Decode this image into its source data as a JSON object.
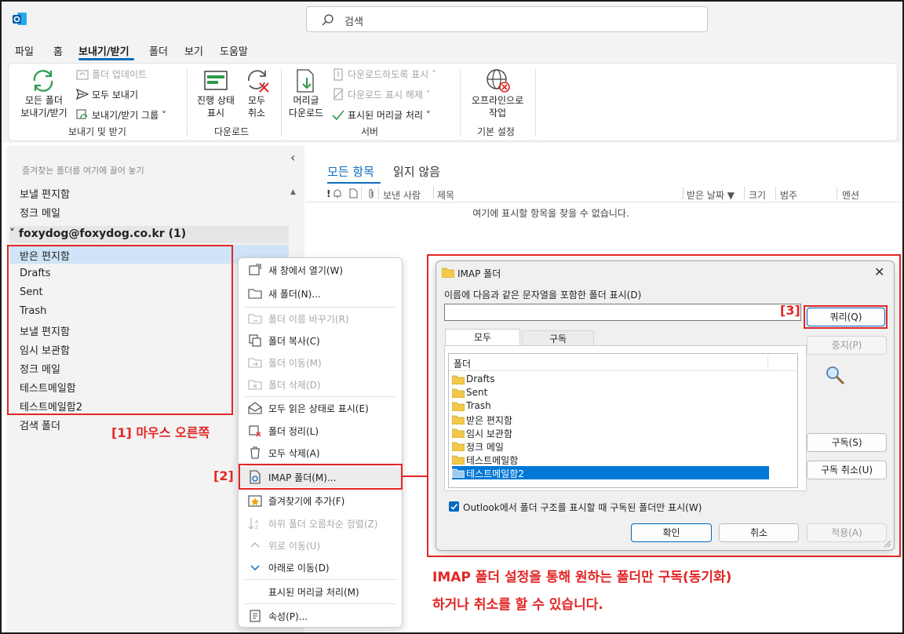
{
  "app": {
    "icon": "outlook-icon"
  },
  "search": {
    "placeholder": "검색"
  },
  "menu": {
    "items": [
      "파일",
      "홈",
      "보내기/받기",
      "폴더",
      "보기",
      "도움말"
    ],
    "active": "보내기/받기"
  },
  "ribbon": {
    "groups": [
      {
        "name": "보내기 및 받기",
        "send_receive_all": "모든 폴더\n보내기/받기",
        "update_folder": "폴더 업데이트",
        "send_all": "모두 보내기",
        "send_receive_groups": "보내기/받기 그룹 ˅"
      },
      {
        "name": "다운로드",
        "show_progress": "진행 상태\n표시",
        "cancel_all": "모두\n취소"
      },
      {
        "name": "서버",
        "download_headers": "머리글\n다운로드",
        "mark_download": "다운로드하도록 표시 ˅",
        "unmark_download": "다운로드 표시 해제 ˅",
        "process_marked": "표시된 머리글 처리 ˅"
      },
      {
        "name": "기본 설정",
        "work_offline": "오프라인으로\n작업"
      }
    ]
  },
  "leftpane": {
    "collapse": "‹",
    "favorites_hint": "즐겨찾는 폴더를 여기에 끌어 놓기",
    "favorites": [
      "보낼 편지함",
      "정크 메일"
    ],
    "account": "˅ foxydog@foxydog.co.kr (1)",
    "folders": [
      "받은 편지함",
      "Drafts",
      "Sent",
      "Trash",
      "보낼 편지함",
      "임시 보관함",
      "정크 메일",
      "테스트메일함",
      "테스트메일함2",
      "검색 폴더"
    ]
  },
  "mailpane": {
    "tabs": [
      "모든 항목",
      "읽지 않음"
    ],
    "columns": [
      "!",
      "보낸 사람",
      "제목",
      "받은 날짜 ▼",
      "크기",
      "범주",
      "멘션"
    ],
    "empty_message": "여기에 표시할 항목을 찾을 수 없습니다."
  },
  "context_menu": {
    "items": [
      {
        "label": "새 창에서 열기(W)",
        "icon": "new-window-icon",
        "enabled": true
      },
      {
        "label": "새 폴더(N)...",
        "icon": "new-folder-icon",
        "enabled": true
      },
      {
        "label": "폴더 이름 바꾸기(R)",
        "icon": "rename-folder-icon",
        "enabled": false
      },
      {
        "label": "폴더 복사(C)",
        "icon": "copy-folder-icon",
        "enabled": true
      },
      {
        "label": "폴더 이동(M)",
        "icon": "move-folder-icon",
        "enabled": false
      },
      {
        "label": "폴더 삭제(D)",
        "icon": "delete-folder-icon",
        "enabled": false
      },
      {
        "label": "모두 읽은 상태로 표시(E)",
        "icon": "mark-read-icon",
        "enabled": true
      },
      {
        "label": "폴더 정리(L)",
        "icon": "cleanup-folder-icon",
        "enabled": true
      },
      {
        "label": "모두 삭제(A)",
        "icon": "trash-icon",
        "enabled": true
      },
      {
        "label": "IMAP 폴더(M)...",
        "icon": "imap-folder-icon",
        "enabled": true
      },
      {
        "label": "즐겨찾기에 추가(F)",
        "icon": "favorite-star-icon",
        "enabled": true
      },
      {
        "label": "하위 폴더 오름차순 정렬(Z)",
        "icon": "sort-ascending-icon",
        "enabled": false
      },
      {
        "label": "위로 이동(U)",
        "icon": "chevron-up-icon",
        "enabled": false
      },
      {
        "label": "아래로 이동(D)",
        "icon": "chevron-down-icon",
        "enabled": true
      },
      {
        "label": "표시된 머리글 처리(M)",
        "icon": "",
        "enabled": true
      },
      {
        "label": "속성(P)...",
        "icon": "properties-icon",
        "enabled": true
      }
    ]
  },
  "imap_dialog": {
    "title": "IMAP 폴더",
    "close": "✕",
    "prompt": "이름에 다음과 같은 문자열을 포함한 폴더 표시(D)",
    "search_value": "",
    "tabs": [
      "모두",
      "구독"
    ],
    "list_header": "폴더",
    "folders": [
      "Drafts",
      "Sent",
      "Trash",
      "받은 편지함",
      "임시 보관함",
      "정크 메일",
      "테스트메일함",
      "테스트메일함2"
    ],
    "selected_folder": "테스트메일함2",
    "buttons": {
      "query": "쿼리(Q)",
      "stop": "중지(P)",
      "subscribe": "구독(S)",
      "unsubscribe": "구독 취소(U)",
      "ok": "확인",
      "cancel": "취소",
      "apply": "적용(A)"
    },
    "checkbox": {
      "label": "Outlook에서 폴더 구조를 표시할 때 구독된 폴더만 표시(W)",
      "checked": true
    }
  },
  "annotations": {
    "step1": "[1] 마우스 오른쪽",
    "step2": "[2]",
    "step3": "[3]",
    "caption_line1": "IMAP 폴더 설정을 통해 원하는 폴더만 구독(동기화)",
    "caption_line2": "하거나 취소를 할 수 있습니다."
  },
  "colors": {
    "accent": "#0f6cbd",
    "annotation": "#e32626",
    "selection": "#cfe4f8"
  }
}
